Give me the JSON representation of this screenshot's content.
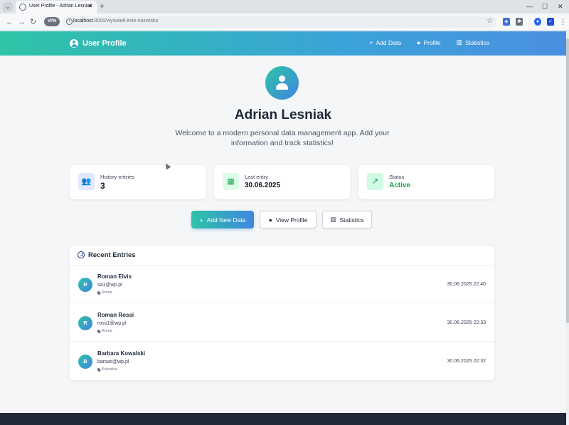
{
  "browser": {
    "tab_title": "User Profile - Adrian Lesniak",
    "new_tab_symbol": "+",
    "url_host": "localhost",
    "url_rest": ":8000/wyswietl-imie-nazwisko",
    "vpn_label": "VPN"
  },
  "header": {
    "brand": "User Profile",
    "nav": [
      {
        "label": "Add Data",
        "icon": "plus-icon"
      },
      {
        "label": "Profile",
        "icon": "user-icon"
      },
      {
        "label": "Statistics",
        "icon": "chart-icon"
      }
    ]
  },
  "hero": {
    "name": "Adrian Lesniak",
    "subtitle": "Welcome to a modern personal data management app. Add your information and track statistics!"
  },
  "stats": [
    {
      "label": "History entries",
      "value": "3",
      "icon": "users-icon",
      "icon_bg": "#e0e7ff",
      "icon_color": "#4f46e5",
      "value_color": "#111827"
    },
    {
      "label": "Last entry",
      "value": "30.06.2025",
      "icon": "calendar-check-icon",
      "icon_bg": "#dcfce7",
      "icon_color": "#16a34a",
      "value_color": "#111827"
    },
    {
      "label": "Status",
      "value": "Active",
      "icon": "line-chart-icon",
      "icon_bg": "#d1fae5",
      "icon_color": "#059669",
      "value_color": "#16a34a"
    }
  ],
  "actions": {
    "add": "Add New Data",
    "view": "View Profile",
    "stats": "Statistics"
  },
  "entries": {
    "title": "Recent Entries",
    "items": [
      {
        "initial": "R",
        "name": "Roman Elvis",
        "email": "sa1@wp.pl",
        "city": "Roma",
        "time": "30.06.2025 22:40"
      },
      {
        "initial": "R",
        "name": "Roman Rossi",
        "email": "ross1@wp.pl",
        "city": "Roma",
        "time": "30.06.2025 22:33"
      },
      {
        "initial": "B",
        "name": "Barbara Kowalski",
        "email": "barsas@wp.pl",
        "city": "Katowice",
        "time": "30.06.2025 22:32"
      }
    ]
  },
  "colors": {
    "accent_start": "#2ec4a6",
    "accent_end": "#3f86e0",
    "active_status": "#16a34a"
  }
}
